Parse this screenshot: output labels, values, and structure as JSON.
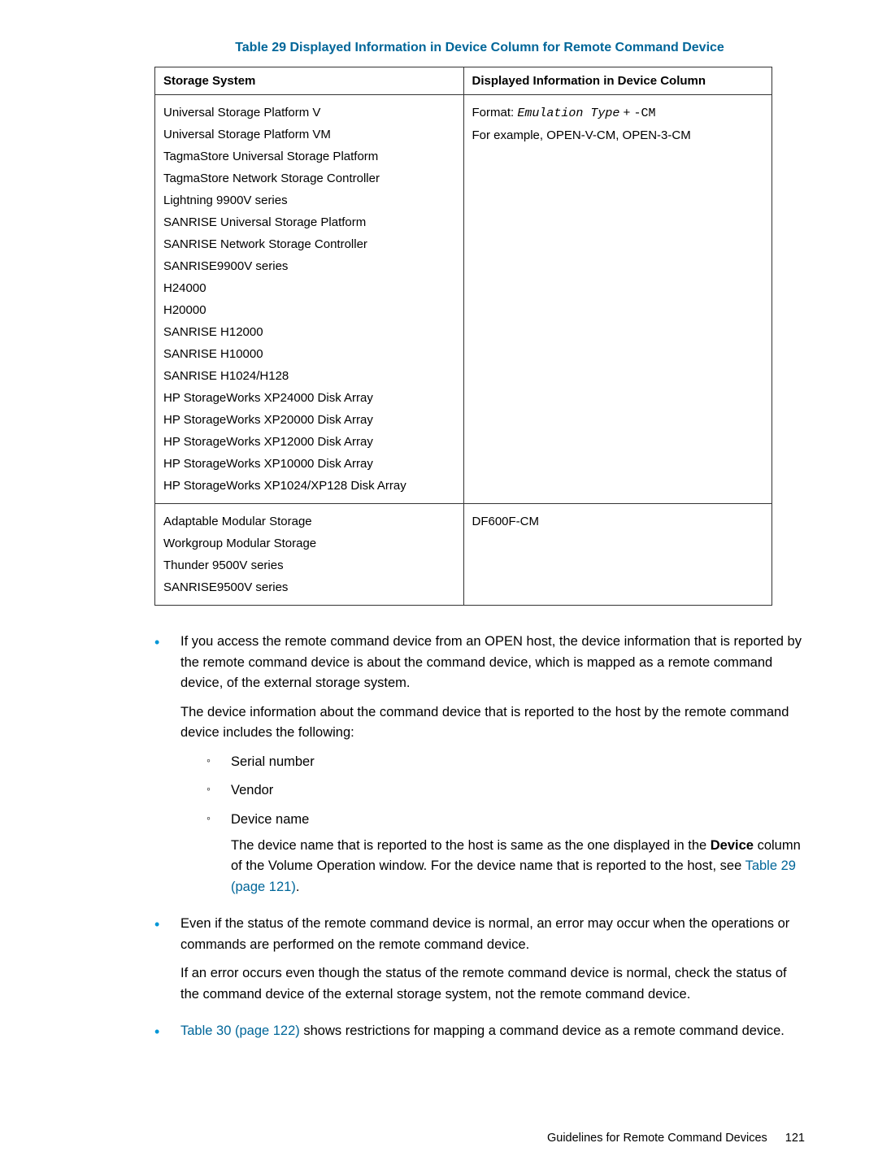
{
  "table": {
    "title": "Table 29 Displayed Information in Device Column for Remote Command Device",
    "headers": [
      "Storage System",
      "Displayed Information in Device Column"
    ],
    "rows": [
      {
        "col1_lines": [
          "Universal Storage Platform V",
          "Universal Storage Platform VM",
          "TagmaStore Universal Storage Platform",
          "TagmaStore Network Storage Controller",
          "Lightning 9900V series",
          "SANRISE Universal Storage Platform",
          "SANRISE Network Storage Controller",
          "SANRISE9900V series",
          "H24000",
          "H20000",
          "SANRISE H12000",
          "SANRISE H10000",
          "SANRISE H1024/H128",
          "HP StorageWorks XP24000 Disk Array",
          "HP StorageWorks XP20000 Disk Array",
          "HP StorageWorks XP12000 Disk Array",
          "HP StorageWorks XP10000 Disk Array",
          "HP StorageWorks XP1024/XP128 Disk Array"
        ],
        "col2_format_prefix": "Format: ",
        "col2_format_emu": "Emulation Type",
        "col2_format_suffix": " + ",
        "col2_format_cm": "-CM",
        "col2_example": "For example, OPEN-V-CM, OPEN-3-CM"
      },
      {
        "col1_lines": [
          "Adaptable Modular Storage",
          "Workgroup Modular Storage",
          "Thunder 9500V series",
          "SANRISE9500V series"
        ],
        "col2_text": "DF600F-CM"
      }
    ]
  },
  "bullets": {
    "b1": {
      "p1": "If you access the remote command device from an OPEN host, the device information that is reported by the remote command device is about the command device, which is mapped as a remote command device, of the external storage system.",
      "p2": "The device information about the command device that is reported to the host by the remote command device includes the following:",
      "sub": {
        "s1": "Serial number",
        "s2": "Vendor",
        "s3_label": "Device name",
        "s3_p_pre": "The device name that is reported to the host is same as the one displayed in the ",
        "s3_device": "Device",
        "s3_p_mid": " column of the Volume Operation window. For the device name that is reported to the host, see ",
        "s3_link": "Table 29 (page 121)",
        "s3_p_end": "."
      }
    },
    "b2": {
      "p1": "Even if the status of the remote command device is normal, an error may occur when the operations or commands are performed on the remote command device.",
      "p2": "If an error occurs even though the status of the remote command device is normal, check the status of the command device of the external storage system, not the remote command device."
    },
    "b3": {
      "link": "Table 30 (page 122)",
      "text": " shows restrictions for mapping a command device as a remote command device."
    }
  },
  "footer": {
    "label": "Guidelines for Remote Command Devices",
    "page": "121"
  }
}
